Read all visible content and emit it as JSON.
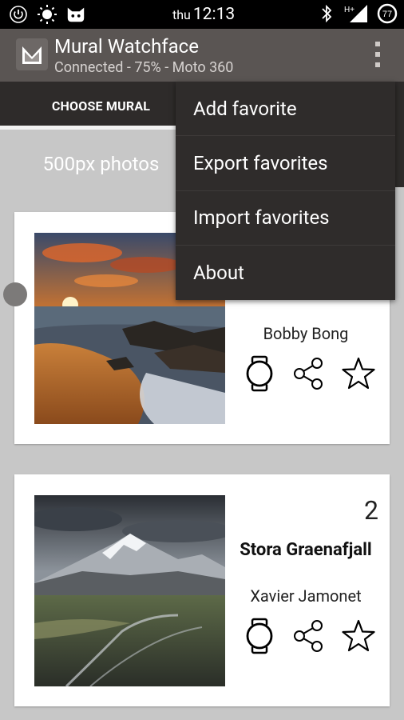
{
  "status_bar": {
    "day": "thu",
    "time": "12:13",
    "battery": "77",
    "network": "H+",
    "icons": [
      "power-icon",
      "brightness-icon",
      "cyanogen-icon",
      "bluetooth-icon",
      "signal-icon",
      "battery-icon"
    ]
  },
  "action_bar": {
    "title": "Mural Watchface",
    "subtitle": "Connected - 75% - Moto 360",
    "overflow_icon": "overflow-menu-icon"
  },
  "tabs": [
    {
      "label": "CHOOSE MURAL",
      "selected": true
    }
  ],
  "source_header": "500px photos",
  "overflow_menu": {
    "items": [
      "Add favorite",
      "Export favorites",
      "Import favorites",
      "About"
    ]
  },
  "cards": [
    {
      "number": "",
      "title": "",
      "author": "Bobby Bong",
      "photo": "sunset-beach-rocks",
      "actions": [
        "watch-icon",
        "share-icon",
        "star-icon"
      ]
    },
    {
      "number": "2",
      "title": "Stora Graenafjall",
      "author": "Xavier Jamonet",
      "photo": "mountain-landscape",
      "actions": [
        "watch-icon",
        "share-icon",
        "star-icon"
      ]
    }
  ],
  "colors": {
    "status_bar": "#000000",
    "action_bar": "#5a5553",
    "tab_bar": "#2e2b2a",
    "background": "#c7c7c7",
    "menu": "#2f2c2b",
    "card": "#ffffff"
  }
}
